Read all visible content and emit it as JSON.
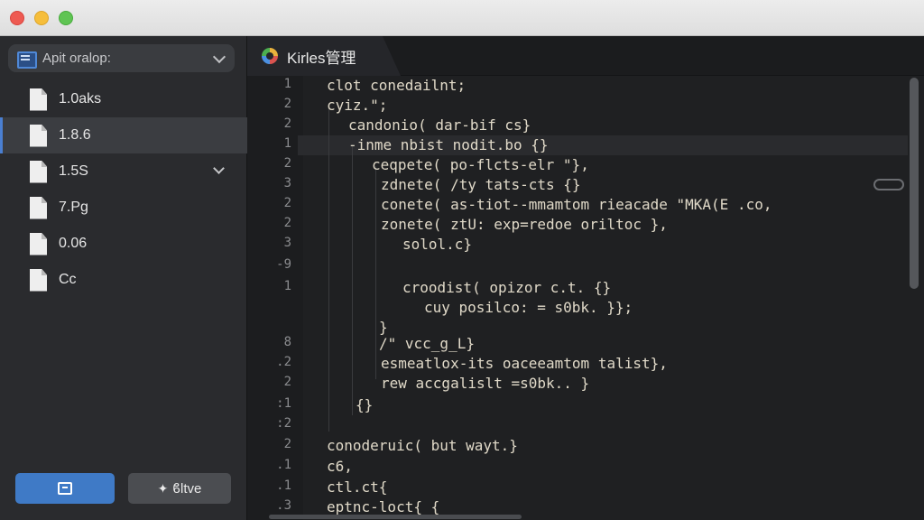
{
  "window": {
    "controls": [
      "close",
      "minimize",
      "zoom"
    ]
  },
  "sidebar": {
    "app_selector": {
      "label": "Apit oralop:",
      "icon": "app-window-icon"
    },
    "files": [
      {
        "name": "1.0aks",
        "icon": "file-icon",
        "selected": false,
        "expandable": false
      },
      {
        "name": "1.8.6",
        "icon": "file-icon",
        "selected": true,
        "expandable": false
      },
      {
        "name": "1.5S",
        "icon": "file-icon",
        "selected": false,
        "expandable": true
      },
      {
        "name": "7.Pg",
        "icon": "file-icon",
        "selected": false,
        "expandable": false
      },
      {
        "name": "0.06",
        "icon": "file-icon",
        "selected": false,
        "expandable": false
      },
      {
        "name": "Cc",
        "icon": "file-icon",
        "selected": false,
        "expandable": false
      }
    ],
    "primary_button": {
      "icon": "save-icon"
    },
    "secondary_button": {
      "label": "ϐltve",
      "icon": "magic-wand-icon"
    }
  },
  "editor": {
    "tab": {
      "label": "Kirles管理",
      "icon": "colorful-ring-icon"
    },
    "line_numbers": [
      "1",
      "2",
      "2",
      "1",
      "2",
      "3",
      "2",
      "2",
      "3",
      "-9",
      "1",
      "",
      "",
      "8",
      ".2",
      "2",
      ":1",
      ":2",
      "2",
      ".1",
      ".1",
      ".3"
    ],
    "code_lines": [
      "clot conedailnt;",
      "cyiz.\";",
      "candonio( dar-bif cs}",
      "-inme nbist nodit.bo {}",
      "ceqpete( po-flcts-elr \"},",
      "zdnete( /ty tats-cts {}",
      "conete( as-tiot--mmamtom rieacade \"MKA(E .co,",
      "zonete( ztU: exp=redoe oriltoc },",
      "solol.c}",
      "",
      "croodist( opizor c.t. {}",
      "cuy posilco: = s0bk. }};",
      "}",
      "/\" vcc_g_L}",
      "esmeatlox-its oaceeamtom talist},",
      "rew accgalislt =s0bk.. }",
      "{}",
      "",
      "conoderuic( but wayt.}",
      "c6,",
      "ctl.ct{",
      "eptnc-loct{ {"
    ]
  },
  "colors": {
    "accent": "#3f7ac6",
    "sidebar_bg": "#2a2b2e",
    "editor_bg": "#1f2022",
    "code_text": "#e0d9c8"
  }
}
